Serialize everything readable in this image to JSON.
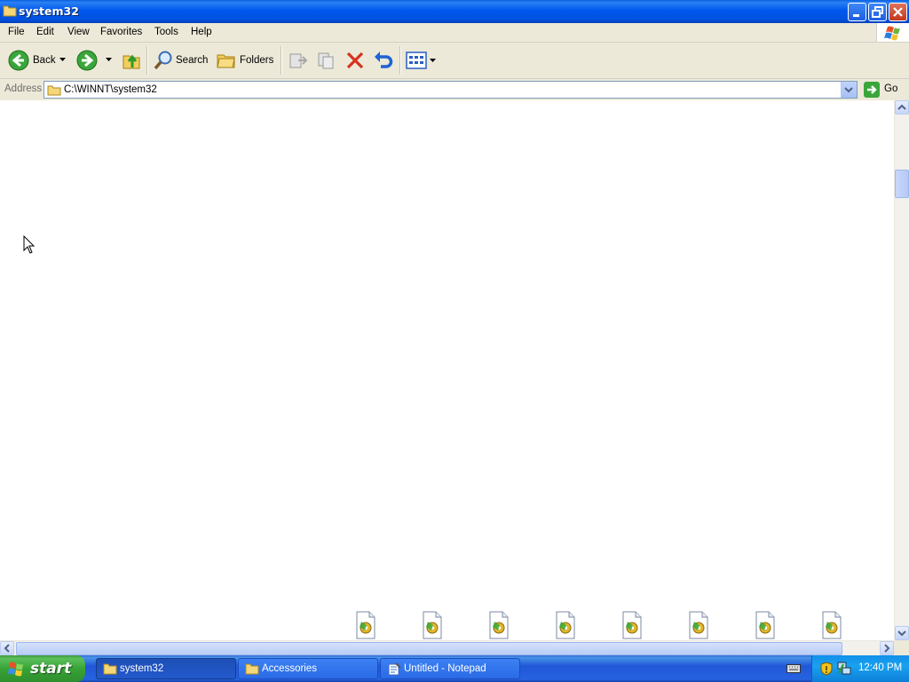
{
  "window": {
    "title": "system32",
    "controls": [
      "minimize",
      "restore",
      "close"
    ]
  },
  "menu": {
    "items": [
      "File",
      "Edit",
      "View",
      "Favorites",
      "Tools",
      "Help"
    ]
  },
  "toolbar": {
    "back_label": "Back",
    "search_label": "Search",
    "folders_label": "Folders"
  },
  "address": {
    "label": "Address",
    "value": "C:\\WINNT\\system32",
    "go_label": "Go"
  },
  "content": {
    "file_icon_type": "system-file-gear-icon",
    "visible_icon_count": 8
  },
  "taskbar": {
    "start_label": "start",
    "tasks": [
      {
        "label": "system32",
        "icon": "folder-icon",
        "active": true
      },
      {
        "label": "Accessories",
        "icon": "folder-icon",
        "active": false
      },
      {
        "label": "Untitled - Notepad",
        "icon": "notepad-icon",
        "active": false
      }
    ],
    "clock": "12:40 PM"
  },
  "colors": {
    "titlebar": "#0058ee",
    "taskbar": "#2157d7",
    "start_button": "#37a336",
    "chrome": "#ece9d8",
    "tray": "#19a1f0"
  }
}
